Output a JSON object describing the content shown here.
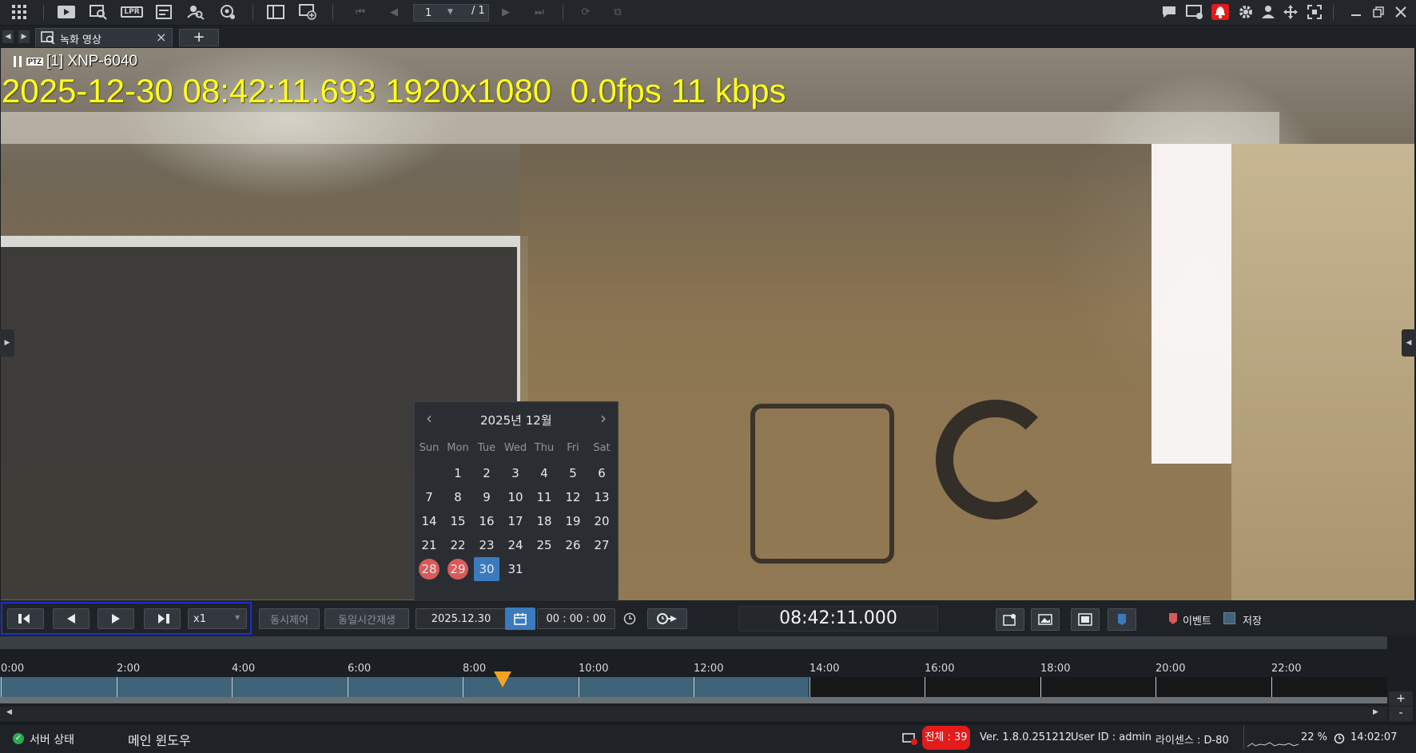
{
  "toolbar": {
    "current_page": "1",
    "total_pages": "/ 1",
    "lpr_label": "LPR"
  },
  "tabs": [
    {
      "label": "녹화 영상"
    }
  ],
  "video": {
    "camera_name": "[1] XNP-6040",
    "ptz_badge": "PTZ",
    "osd": "2025-12-30 08:42:11.693 1920x1080  0.0fps 11 kbps"
  },
  "calendar": {
    "title": "2025년 12월",
    "weekdays": [
      "Sun",
      "Mon",
      "Tue",
      "Wed",
      "Thu",
      "Fri",
      "Sat"
    ],
    "days": [
      "1",
      "2",
      "3",
      "4",
      "5",
      "6",
      "7",
      "8",
      "9",
      "10",
      "11",
      "12",
      "13",
      "14",
      "15",
      "16",
      "17",
      "18",
      "19",
      "20",
      "21",
      "22",
      "23",
      "24",
      "25",
      "26",
      "27",
      "28",
      "29",
      "30",
      "31"
    ],
    "first_weekday": 1,
    "recorded_days": [
      "28",
      "29"
    ],
    "selected_day": "30"
  },
  "controls": {
    "speed": "x1",
    "sync_control": "동시제어",
    "same_time_play": "동일시간재생",
    "date": "2025.12.30",
    "time": "00 : 00 : 00",
    "current_time": "08:42:11.000",
    "legend_event": "이벤트",
    "legend_storage": "저장"
  },
  "timeline": {
    "labels": [
      "0:00",
      "2:00",
      "4:00",
      "6:00",
      "8:00",
      "10:00",
      "12:00",
      "14:00",
      "16:00",
      "18:00",
      "20:00",
      "22:00"
    ],
    "recorded_until_hour": 14,
    "cursor_hour": 8.7,
    "zoom_in": "+",
    "zoom_out": "-"
  },
  "status": {
    "server_status": "서버 상태",
    "main_window": "메인 윈도우",
    "total": "전체 : 39",
    "version": "Ver. 1.8.0.251212",
    "user": "User ID : admin",
    "license": "라이센스 : D-80",
    "cpu": "22 %",
    "clock": "14:02:07"
  },
  "colors": {
    "accent_blue": "#3a7bbd",
    "record_red": "#d95a5a",
    "osd_yellow": "#ffff20",
    "timeline_recorded": "#3f6378",
    "alert_red": "#e31b1b"
  }
}
